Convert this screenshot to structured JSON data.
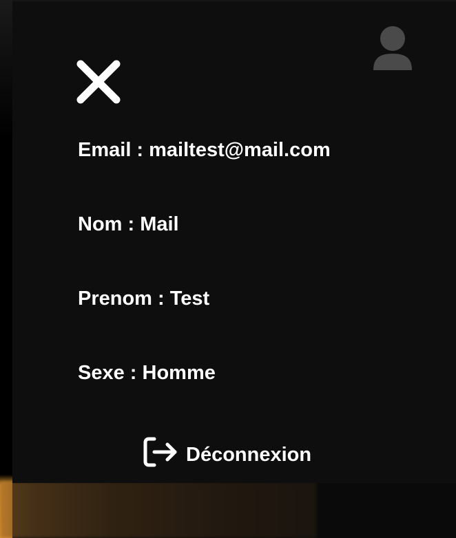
{
  "profile_panel": {
    "close_icon": "close-icon",
    "avatar_icon": "user-avatar-icon",
    "fields": {
      "email": "Email : mailtest@mail.com",
      "nom": "Nom : Mail",
      "prenom": "Prenom : Test",
      "sexe": "Sexe : Homme"
    },
    "logout": {
      "icon": "logout-icon",
      "label": "Déconnexion"
    }
  },
  "colors": {
    "panel_background": "#0e0e0e",
    "text": "#ffffff",
    "avatar": "#4a4a4a",
    "backdrop_accent": "#e29a35"
  }
}
